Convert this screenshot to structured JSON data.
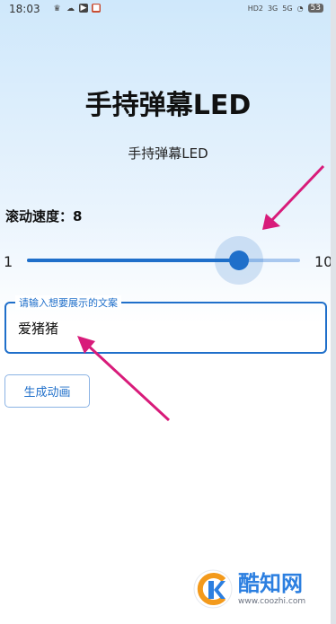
{
  "status_bar": {
    "time": "18:03",
    "left_icons": [
      "crown-icon",
      "cloud-icon",
      "play-icon",
      "app-icon"
    ],
    "hd": "HD2",
    "sig1": "3G",
    "sig2": "5G",
    "battery": "53"
  },
  "app": {
    "title": "手持弹幕LED",
    "subtitle": "手持弹幕LED",
    "speed_label": "滚动速度：8"
  },
  "slider": {
    "min_label": "1",
    "max_label": "10",
    "min": 1,
    "max": 10,
    "value": 8
  },
  "text_field": {
    "label": "请输入想要展示的文案",
    "value": "爱猪猪"
  },
  "button": {
    "label": "生成动画"
  },
  "watermark": {
    "name": "酷知网",
    "url": "www.coozhi.com"
  },
  "colors": {
    "accent": "#1f6fca",
    "arrow": "#d81b7a"
  }
}
